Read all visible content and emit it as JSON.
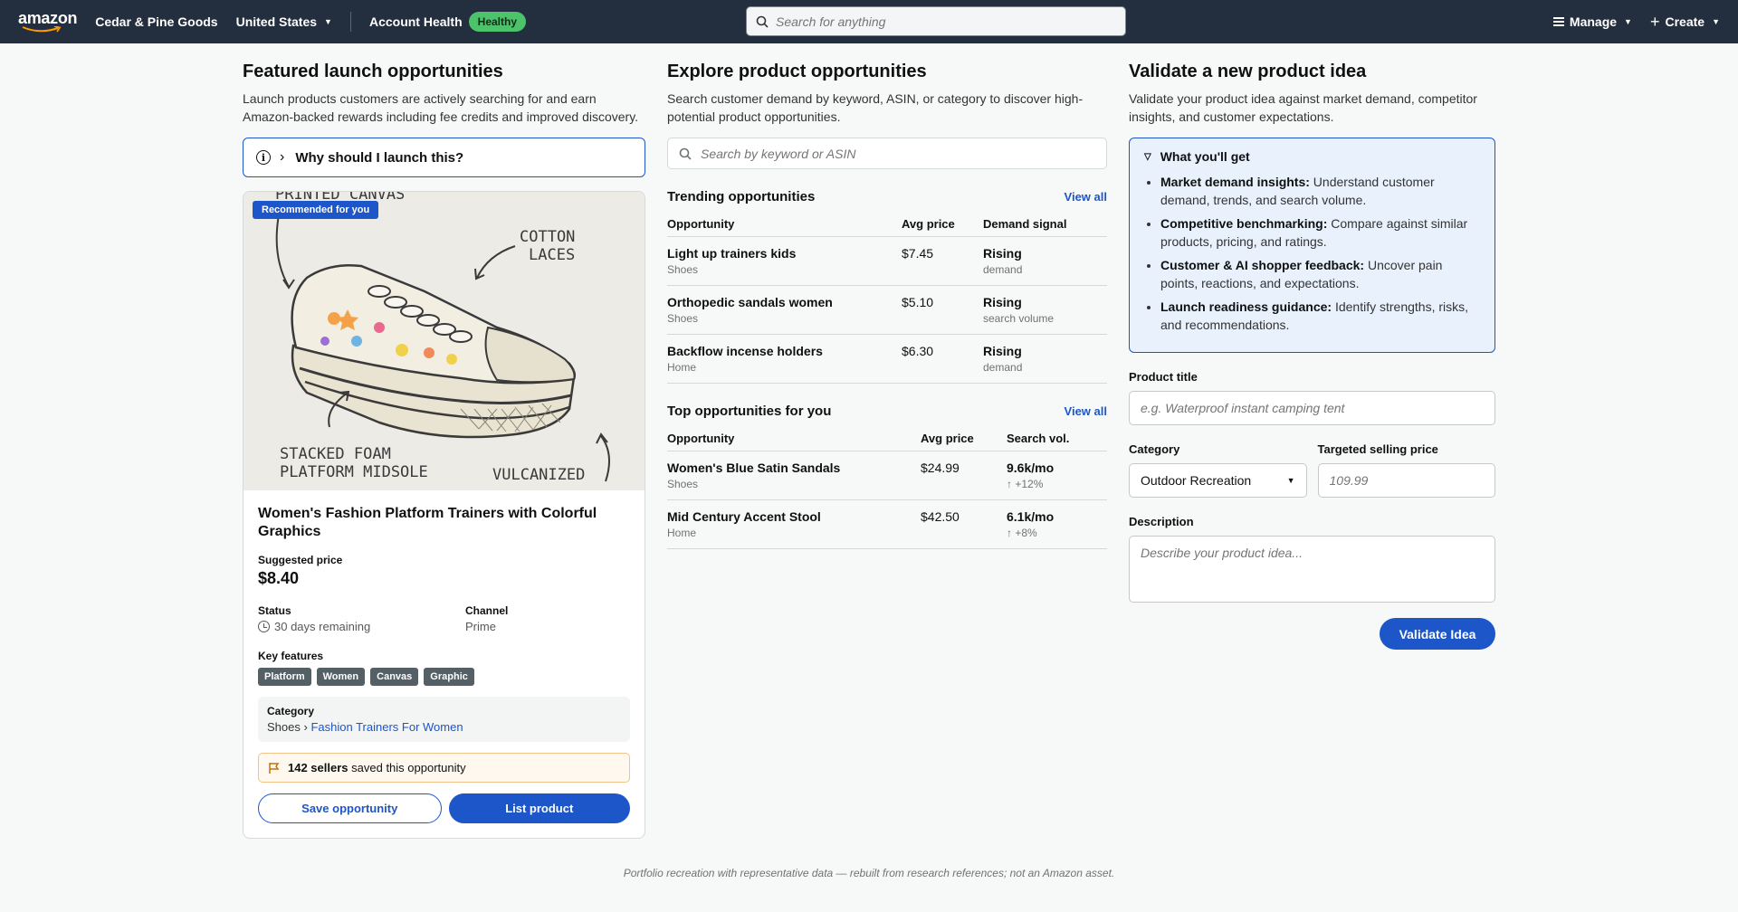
{
  "nav": {
    "logo": "amazon",
    "store": "Cedar & Pine Goods",
    "region": "United States",
    "health_label": "Account Health",
    "health_status": "Healthy",
    "search_placeholder": "Search for anything",
    "manage": "Manage",
    "create": "Create"
  },
  "featured": {
    "title": "Featured launch opportunities",
    "subtitle": "Launch products customers are actively searching for and earn Amazon-backed rewards including fee credits and improved discovery.",
    "why": "Why should I launch this?",
    "card": {
      "badge": "Recommended for you",
      "sketch_labels": [
        "PRINTED CANVAS",
        "COTTON LACES",
        "STACKED FOAM PLATFORM MIDSOLE",
        "VULCANIZED"
      ],
      "product_title": "Women's Fashion Platform Trainers with Colorful Graphics",
      "price_label": "Suggested price",
      "price": "$8.40",
      "status_label": "Status",
      "status_value": "30 days remaining",
      "channel_label": "Channel",
      "channel_value": "Prime",
      "features_label": "Key features",
      "features": [
        "Platform",
        "Women",
        "Canvas",
        "Graphic"
      ],
      "category_label": "Category",
      "category_root": "Shoes",
      "category_sep": "›",
      "category_leaf": "Fashion Trainers For Women",
      "sellers_count": "142 sellers",
      "sellers_text": "saved this opportunity",
      "save_button": "Save opportunity",
      "list_button": "List product"
    }
  },
  "explore": {
    "title": "Explore product opportunities",
    "subtitle": "Search customer demand by keyword, ASIN, or category to discover high-potential product opportunities.",
    "search_placeholder": "Search by keyword or ASIN",
    "trending": {
      "title": "Trending opportunities",
      "view_all": "View all",
      "columns": [
        "Opportunity",
        "Avg price",
        "Demand signal"
      ],
      "rows": [
        {
          "name": "Light up trainers kids",
          "category": "Shoes",
          "price": "$7.45",
          "signal": "Rising",
          "signal_sub": "demand"
        },
        {
          "name": "Orthopedic sandals women",
          "category": "Shoes",
          "price": "$5.10",
          "signal": "Rising",
          "signal_sub": "search volume"
        },
        {
          "name": "Backflow incense holders",
          "category": "Home",
          "price": "$6.30",
          "signal": "Rising",
          "signal_sub": "demand"
        }
      ]
    },
    "top": {
      "title": "Top opportunities for you",
      "view_all": "View all",
      "columns": [
        "Opportunity",
        "Avg price",
        "Search vol."
      ],
      "rows": [
        {
          "name": "Women's Blue Satin Sandals",
          "category": "Shoes",
          "price": "$24.99",
          "volume": "9.6k/mo",
          "change": "↑ +12%"
        },
        {
          "name": "Mid Century Accent Stool",
          "category": "Home",
          "price": "$42.50",
          "volume": "6.1k/mo",
          "change": "↑ +8%"
        }
      ]
    }
  },
  "validate": {
    "title": "Validate a new product idea",
    "subtitle": "Validate your product idea against market demand, competitor insights, and customer expectations.",
    "wyg_title": "What you'll get",
    "wyg_items": [
      {
        "bold": "Market demand insights:",
        "text": " Understand customer demand, trends, and search volume."
      },
      {
        "bold": "Competitive benchmarking:",
        "text": " Compare against similar products, pricing, and ratings."
      },
      {
        "bold": "Customer & AI shopper feedback:",
        "text": " Uncover pain points, reactions, and expectations."
      },
      {
        "bold": "Launch readiness guidance:",
        "text": " Identify strengths, risks, and recommendations."
      }
    ],
    "product_title_label": "Product title",
    "product_title_placeholder": "e.g. Waterproof instant camping tent",
    "category_label": "Category",
    "category_value": "Outdoor Recreation",
    "price_label": "Targeted selling price",
    "price_placeholder": "109.99",
    "description_label": "Description",
    "description_placeholder": "Describe your product idea...",
    "button": "Validate Idea"
  },
  "footer": "Portfolio recreation with representative data — rebuilt from research references; not an Amazon asset.",
  "colors": {
    "nav_bg": "#232f3e",
    "accent": "#1d56c9",
    "healthy": "#4cc26a"
  }
}
